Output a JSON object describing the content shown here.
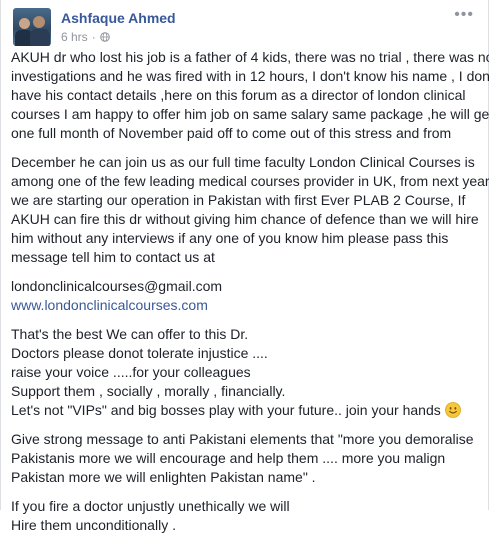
{
  "post": {
    "author": "Ashfaque Ahmed",
    "time": "6 hrs",
    "separator": "·",
    "more_glyph": "•••",
    "privacy_icon": "globe-icon",
    "paragraphs": [
      {
        "lines": [
          "AKUH dr who lost his job is a father of 4 kids, there was no trial , there was no",
          "investigations and he was fired with in 12 hours, I don't know his name , I don't",
          "have his contact details ,here on this forum as a director of london clinical",
          "courses I am happy to offer him job on same salary same package ,he will get",
          "one full month of November paid off to come out of this stress and from"
        ]
      },
      {
        "lines": [
          "December he can join us as our full time faculty London Clinical Courses is",
          "among one of the few leading medical courses provider in UK, from next year",
          "we are starting our operation in Pakistan with first Ever PLAB 2 Course, If",
          "AKUH can fire this dr without giving him chance of defence than we will hire",
          "him without any interviews if any one of you know him please pass this",
          "message tell him to contact us at"
        ]
      },
      {
        "email": "londonclinicalcourses@gmail.com",
        "website": "www.londonclinicalcourses.com"
      },
      {
        "lines": [
          "That's the best We can offer to this Dr.",
          "Doctors please donot tolerate injustice ....",
          "raise your voice .....for your colleagues",
          "Support them , socially , morally , financially.",
          "Let's not \"VIPs\" and big bosses play with your future.. join your hands"
        ],
        "emoji": "smiley-icon"
      },
      {
        "lines": [
          "Give strong message to anti Pakistani elements that \"more you demoralise",
          "Pakistanis more we will encourage and help them .... more you malign",
          "Pakistan more we will enlighten Pakistan name\" ."
        ]
      },
      {
        "lines": [
          "If you fire a doctor unjustly unethically we will",
          "Hire them unconditionally ."
        ]
      }
    ]
  }
}
